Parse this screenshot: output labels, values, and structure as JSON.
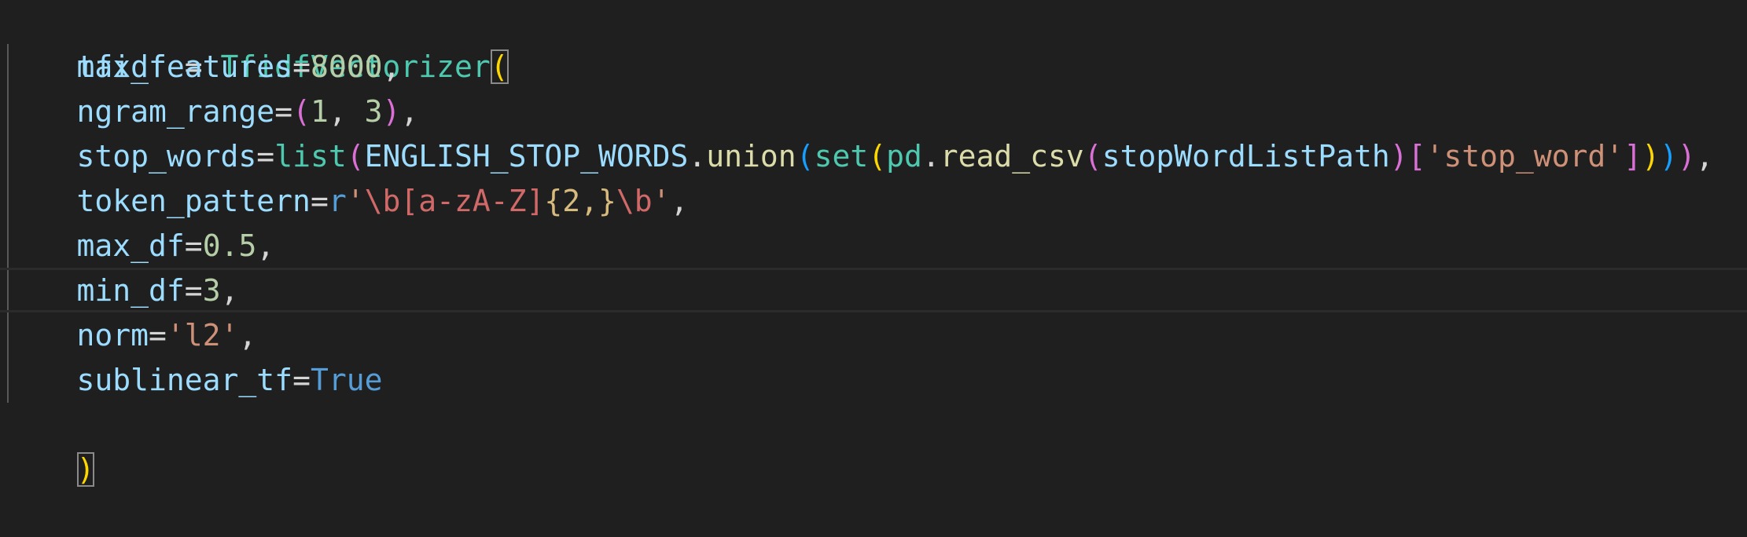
{
  "editor": {
    "language": "python",
    "theme_colors": {
      "background": "#1f1f1f",
      "variable": "#9cdcfe",
      "class": "#4ec9b0",
      "number": "#b5cea8",
      "string": "#ce9178",
      "keyword": "#569cd6",
      "function": "#dcdcaa",
      "bracket_level1": "#ffd700",
      "bracket_level2": "#da70d6",
      "bracket_level3": "#179fff"
    },
    "lines": [
      {
        "tokens": [
          "tfidf",
          " = ",
          "TfidfVectorizer",
          "("
        ]
      },
      {
        "tokens": [
          "max_features",
          "=",
          "8000",
          ","
        ]
      },
      {
        "tokens": [
          "ngram_range",
          "=",
          "(",
          "1",
          ", ",
          "3",
          ")",
          ","
        ]
      },
      {
        "tokens": [
          "stop_words",
          "=",
          "list",
          "(",
          "ENGLISH_STOP_WORDS",
          ".",
          "union",
          "(",
          "set",
          "(",
          "pd",
          ".",
          "read_csv",
          "(",
          "stopWordListPath",
          ")",
          "[",
          "'stop_word'",
          "]",
          ")",
          ")",
          ")",
          ","
        ]
      },
      {
        "tokens": [
          "token_pattern",
          "=",
          "r",
          "'",
          "\\b",
          "[a-zA-Z]",
          "{2,}",
          "\\b",
          "'",
          ","
        ]
      },
      {
        "tokens": [
          "max_df",
          "=",
          "0.5",
          ","
        ]
      },
      {
        "tokens": [
          "min_df",
          "=",
          "3",
          ","
        ]
      },
      {
        "tokens": [
          "norm",
          "=",
          "'l2'",
          ","
        ]
      },
      {
        "tokens": [
          "sublinear_tf",
          "=",
          "True"
        ]
      },
      {
        "tokens": [
          ")"
        ]
      }
    ]
  }
}
